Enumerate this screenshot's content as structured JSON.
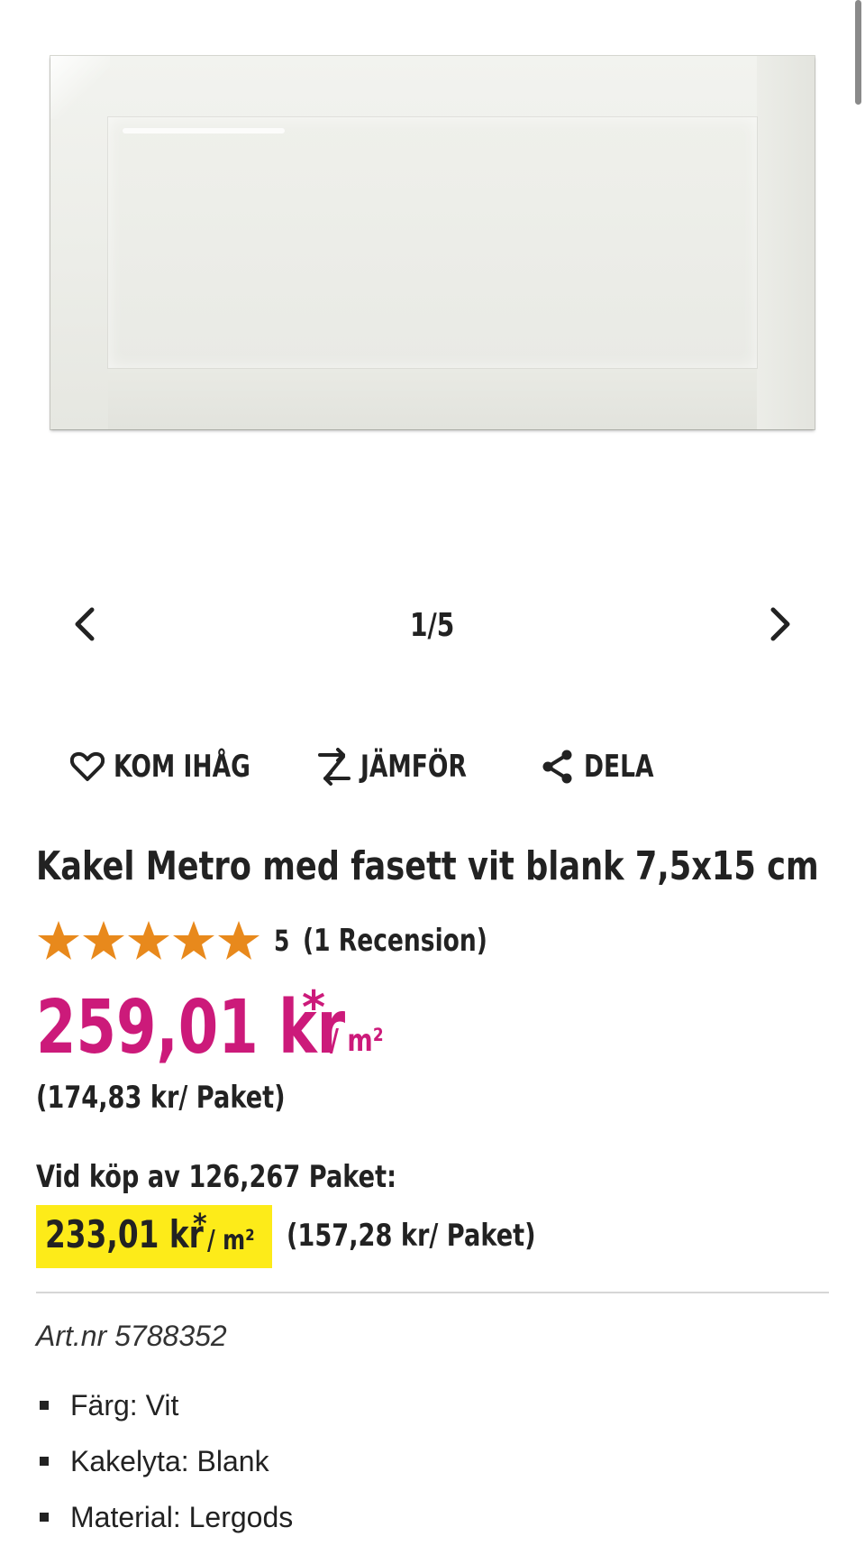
{
  "gallery": {
    "counter": "1/5",
    "prev_icon": "chevron-left-icon",
    "next_icon": "chevron-right-icon"
  },
  "actions": {
    "remember": {
      "label": "KOM IHÅG",
      "icon": "heart-icon"
    },
    "compare": {
      "label": "JÄMFÖR",
      "icon": "compare-arrows-icon"
    },
    "share": {
      "label": "DELA",
      "icon": "share-icon"
    }
  },
  "product": {
    "title": "Kakel Metro med fasett vit blank 7,5x15 cm",
    "rating": {
      "stars": 5,
      "value": "5",
      "reviews_label": "(1 Recension)",
      "star_color": "#e8891c"
    },
    "price": {
      "amount": "259,01 kr",
      "asterisk": "*",
      "unit": "/ m²",
      "color": "#cc1a7a"
    },
    "per_pack": "(174,83 kr/ Paket)",
    "bulk": {
      "label": "Vid köp av 126,267 Paket:",
      "amount": "233,01 kr",
      "asterisk": "*",
      "unit": "/ m²",
      "per_pack": "(157,28 kr/ Paket)",
      "highlight_color": "#fdeb19"
    },
    "article_number": "Art.nr 5788352",
    "specs": [
      {
        "text": "Färg: Vit"
      },
      {
        "text": "Kakelyta: Blank"
      },
      {
        "text": "Material: Lergods"
      }
    ]
  }
}
